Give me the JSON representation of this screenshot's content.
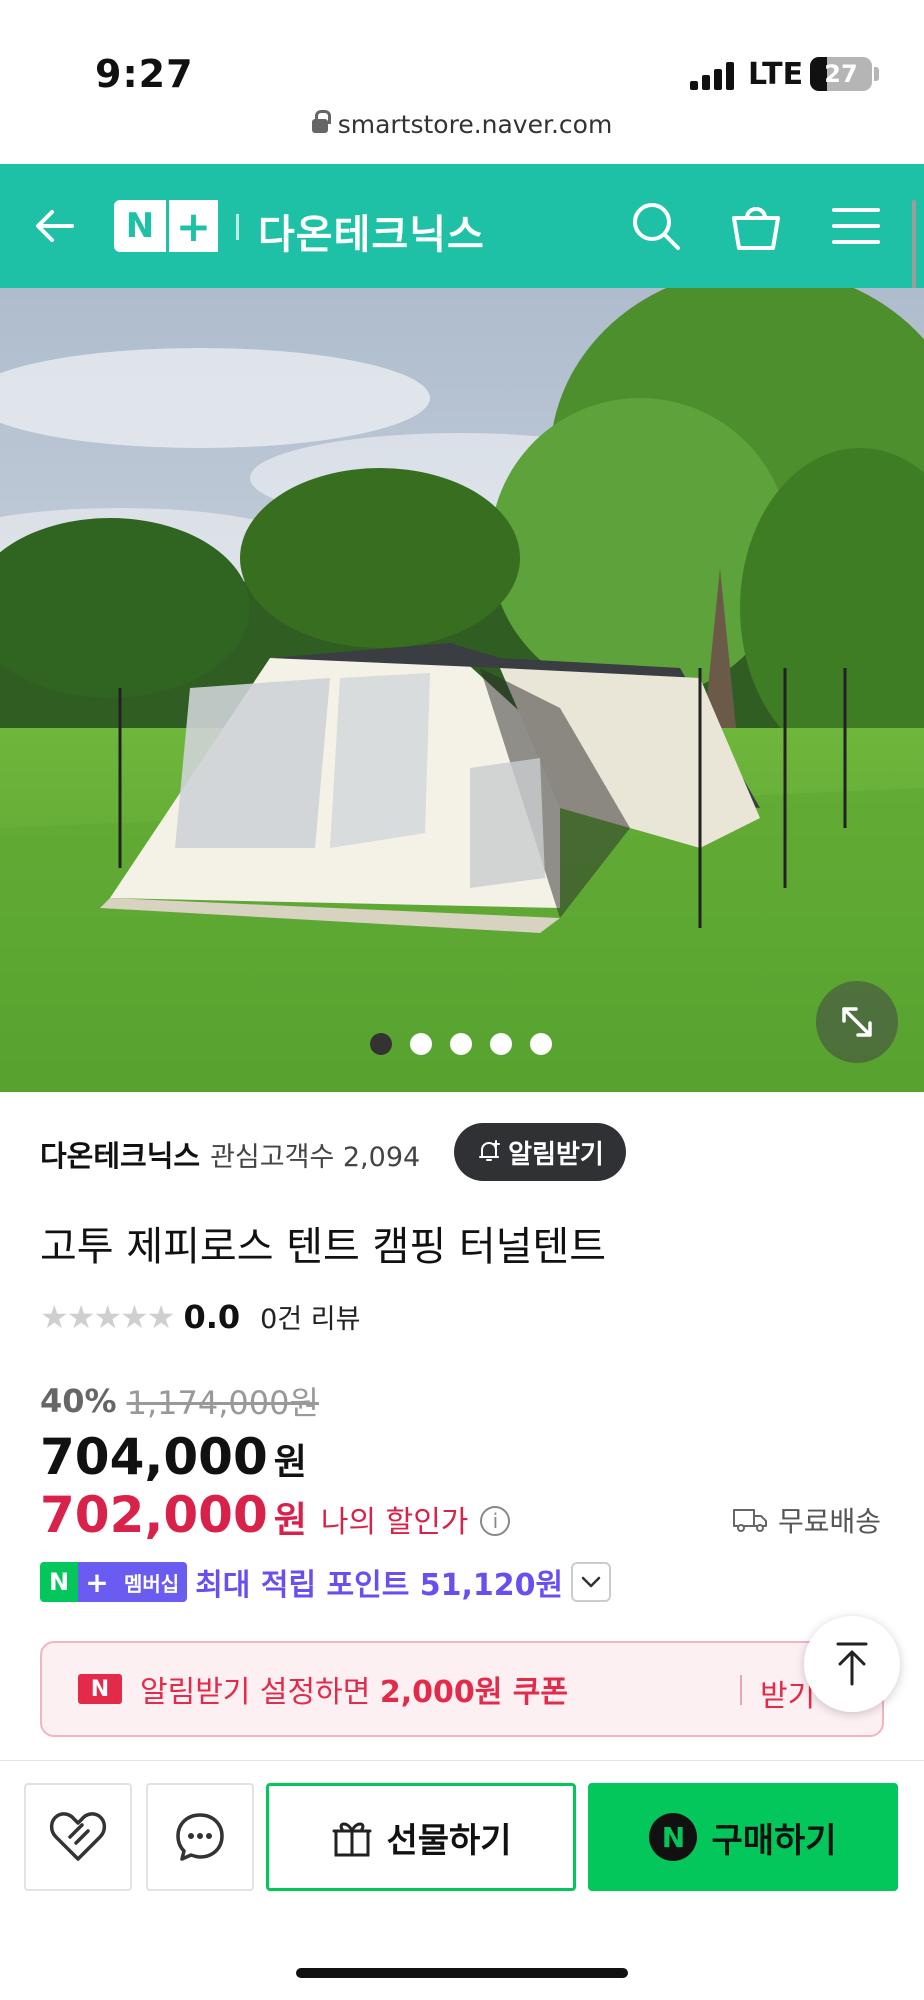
{
  "status_bar": {
    "time": "9:27",
    "network": "LTE",
    "battery": "27",
    "battery_level": 0.27
  },
  "browser": {
    "url": "smartstore.naver.com"
  },
  "nav": {
    "logo_n": "N",
    "logo_plus": "+",
    "store_name": "다온테크닉스",
    "icons": [
      "back-arrow-icon",
      "search-icon",
      "shopping-bag-icon",
      "menu-icon"
    ]
  },
  "gallery": {
    "image_count": 5,
    "active_index": 0,
    "expand_icon": "expand-icon"
  },
  "store": {
    "name": "다온테크닉스",
    "interest_label": "관심고객수 2,094",
    "alarm_button": "알림받기"
  },
  "product": {
    "title": "고투 제피로스 텐트 캠핑 터널텐트",
    "rating_stars": "★★★★★",
    "rating_value": "0.0",
    "review_count": "0건 리뷰",
    "discount_rate": "40%",
    "original_price": "1,174,000원",
    "sale_price": "704,000",
    "sale_price_unit": "원",
    "my_price": "702,000",
    "my_price_unit": "원",
    "my_price_label": "나의 할인가",
    "shipping": "무료배송",
    "membership_badge": {
      "n": "N",
      "plus": "+",
      "label": "멤버십"
    },
    "max_points": "최대 적립 포인트 51,120원"
  },
  "coupon_banner": {
    "badge": "N",
    "text_prefix": "알림받기 설정하면 ",
    "text_amount": "2,000원 쿠폰",
    "action": "받기"
  },
  "bottom_bar": {
    "gift_label": "선물하기",
    "buy_label": "구매하기",
    "buy_badge": "N"
  },
  "colors": {
    "brand_teal": "#1fc1a6",
    "naver_green": "#03c75a",
    "price_red": "#d9224a",
    "points_purple": "#6a4ff0"
  }
}
